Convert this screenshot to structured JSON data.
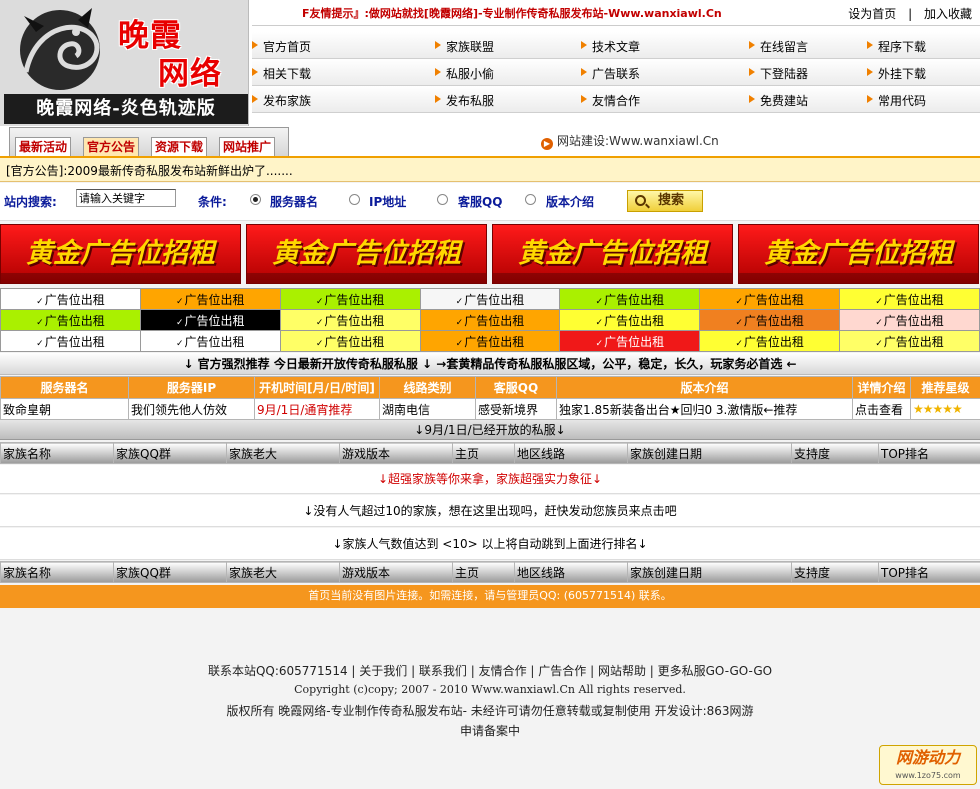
{
  "logo": {
    "title_line1": "晚霞",
    "title_line2": "网络",
    "subtitle": "晚霞网络-炎色轨迹版"
  },
  "topbar": {
    "tip": "F友情提示』:做网站就找[晚霞网络]-专业制作传奇私服发布站-Www.wanxiawl.Cn",
    "set_home": "设为首页",
    "sep": "|",
    "favorite": "加入收藏"
  },
  "nav": {
    "row1": [
      "官方首页",
      "家族联盟",
      "技术文章",
      "在线留言",
      "程序下载"
    ],
    "row2": [
      "相关下载",
      "私服小偷",
      "广告联系",
      "下登陆器",
      "外挂下载"
    ],
    "row3": [
      "发布家族",
      "发布私服",
      "友情合作",
      "免费建站",
      "常用代码"
    ]
  },
  "tabs": [
    "最新活动",
    "官方公告",
    "资源下载",
    "网站推广"
  ],
  "site_build": "网站建设:Www.wanxiawl.Cn",
  "notice": "[官方公告]:2009最新传奇私服发布站新鲜出炉了.......",
  "search": {
    "label": "站内搜索:",
    "input_value": "请输入关键字",
    "condition_label": "条件:",
    "options": [
      "服务器名",
      "IP地址",
      "客服QQ",
      "版本介绍"
    ],
    "button": "搜索"
  },
  "banners": [
    "黄金广告位招租",
    "黄金广告位招租",
    "黄金广告位招租",
    "黄金广告位招租"
  ],
  "ad_slots": {
    "label": "广告位出租",
    "colors": [
      [
        "#ffffff",
        "#ffa500",
        "#aaf000",
        "#f6f6f6",
        "#aaf000",
        "#ffa500",
        "#ffff33"
      ],
      [
        "#aaf000",
        "#ffffff",
        "#ffff66",
        "#ffa500",
        "#ffff33",
        "#f08020",
        "#ffd8d0"
      ],
      [
        "#ffffff",
        "#ffffff",
        "#ffff66",
        "#ffa500",
        "#f01818",
        "#ffff33",
        "#ffff66"
      ]
    ],
    "dark_cell": {
      "row": 1,
      "col": 1,
      "color": "#000000"
    }
  },
  "recommend_bar": "↓ 官方强烈推荐 今日最新开放传奇私服私服 ↓ →套黄精品传奇私服私服区域，公平，稳定，长久，玩家务必首选 ←",
  "server_table": {
    "headers": [
      "服务器名",
      "服务器IP",
      "开机时间[月/日/时间]",
      "线路类别",
      "客服QQ",
      "版本介绍",
      "详情介绍",
      "推荐星级"
    ],
    "rows": [
      [
        "致命皇朝",
        "我们领先他人仿效",
        "9月/1日/通宵推荐",
        "湖南电信",
        "感受新境界",
        "独家1.85新装备出台★回归0 3.激情版←推荐",
        "点击查看",
        "★★★★★"
      ]
    ]
  },
  "today_bar": "↓9月/1日/已经开放的私服↓",
  "family_table": {
    "headers": [
      "家族名称",
      "家族QQ群",
      "家族老大",
      "游戏版本",
      "主页",
      "地区线路",
      "家族创建日期",
      "支持度",
      "TOP排名"
    ]
  },
  "messages": {
    "super": "↓超强家族等你来拿，家族超强实力象征↓",
    "none": "↓没有人气超过10的家族，想在这里出现吗，赶快发动您族员来点击吧",
    "auto": "↓家族人气数值达到 <10> 以上将自动跳到上面进行排名↓"
  },
  "image_bar": "首页当前没有图片连接。如需连接，请与管理员QQ: (605771514) 联系。",
  "footer": {
    "links": "联系本站QQ:605771514 | 关于我们 | 联系我们 | 友情合作 | 广告合作 | 网站帮助 | 更多私服GO-GO-GO",
    "copyright": "Copyright (c)copy; 2007 - 2010 Www.wanxiawl.Cn All rights reserved.",
    "rights": "版权所有 晚霞网络-专业制作传奇私服发布站- 未经许可请勿任意转载或复制使用 开发设计:863网游",
    "icp": "申请备案中"
  },
  "badge": {
    "title": "网游动力",
    "url": "www.1zo75.com"
  },
  "colors": {
    "orange": "#f5961e",
    "red": "#e80000",
    "blue_label": "#0b1b9a"
  }
}
